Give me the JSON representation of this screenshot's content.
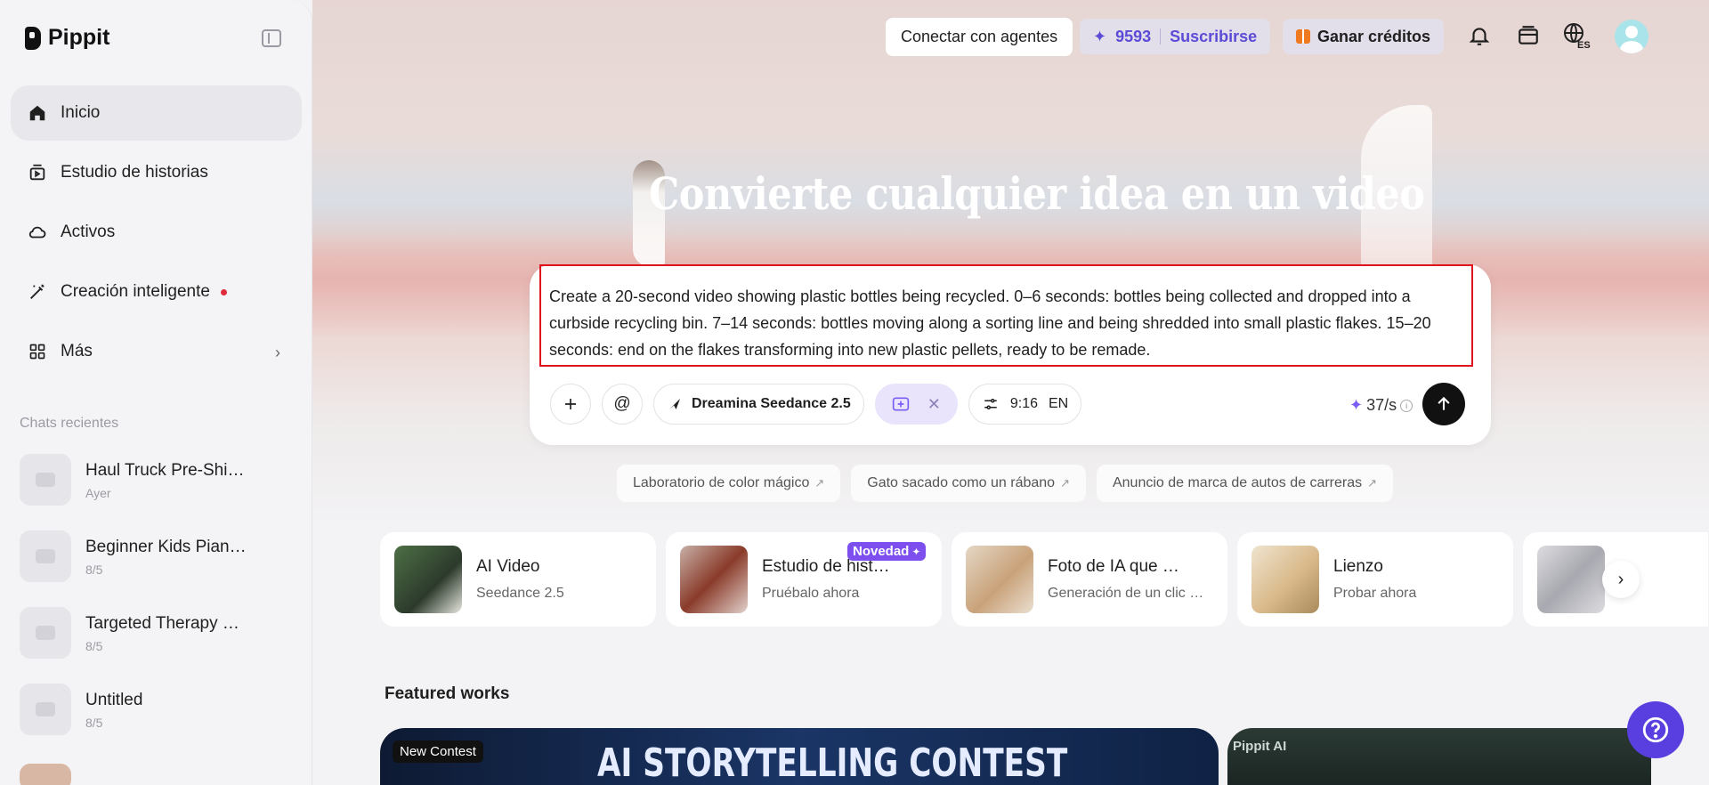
{
  "app": {
    "name": "Pippit"
  },
  "sidebar": {
    "nav": [
      {
        "label": "Inicio",
        "icon": "home-icon",
        "active": true
      },
      {
        "label": "Estudio de historias",
        "icon": "story-studio-icon"
      },
      {
        "label": "Activos",
        "icon": "cloud-icon"
      },
      {
        "label": "Creación inteligente",
        "icon": "magic-wand-icon",
        "has_dot": true
      },
      {
        "label": "Más",
        "icon": "grid-icon",
        "has_chevron": true
      }
    ],
    "recent_title": "Chats recientes",
    "recent_chats": [
      {
        "title": "Haul Truck Pre-Shi…",
        "date": "Ayer"
      },
      {
        "title": "Beginner Kids Pian…",
        "date": "8/5"
      },
      {
        "title": "Targeted Therapy …",
        "date": "8/5"
      },
      {
        "title": "Untitled",
        "date": "8/5"
      }
    ]
  },
  "topbar": {
    "agents_label": "Conectar con agentes",
    "credits": "9593",
    "subscribe_label": "Suscribirse",
    "earn_label": "Ganar créditos",
    "language_badge": "ES"
  },
  "hero": {
    "headline": "Convierte cualquier idea en un video"
  },
  "prompt": {
    "text": "Create a 20-second video showing plastic bottles being recycled. 0–6 seconds: bottles being collected and dropped into a curbside recycling bin. 7–14 seconds: bottles moving along a sorting line and being shredded into small plastic flakes. 15–20 seconds: end on the flakes transforming into new plastic pellets, ready to be remade.",
    "mention_symbol": "@",
    "model_label": "Dreamina Seedance 2.5",
    "aspect_ratio": "9:16",
    "language": "EN",
    "cost": "37/s"
  },
  "suggestions": [
    "Laboratorio de color mágico",
    "Gato sacado como un rábano",
    "Anuncio de marca de autos de carreras"
  ],
  "feature_cards": [
    {
      "title": "AI Video",
      "subtitle": "Seedance 2.5",
      "thumb_color": "#3b5b3a"
    },
    {
      "title": "Estudio de hist…",
      "subtitle": "Pruébalo ahora",
      "badge": "Novedad",
      "thumb_color": "#8a3b2a"
    },
    {
      "title": "Foto de IA que …",
      "subtitle": "Generación de un clic …",
      "thumb_color": "#c9a27a"
    },
    {
      "title": "Lienzo",
      "subtitle": "Probar ahora",
      "thumb_color": "#d9b98a"
    },
    {
      "title": "",
      "subtitle": "",
      "thumb_color": "#c8c8cc"
    }
  ],
  "featured": {
    "title": "Featured works",
    "contest_tag": "New Contest",
    "contest_title": "AI STORYTELLING CONTEST",
    "second_tag": "Pippit AI"
  }
}
